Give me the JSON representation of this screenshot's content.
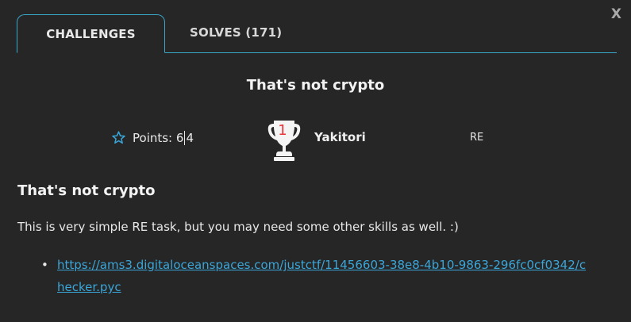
{
  "modal": {
    "close_label": "X"
  },
  "tabs": [
    {
      "label": "CHALLENGES",
      "active": true
    },
    {
      "label": "SOLVES (171)",
      "active": false
    }
  ],
  "challenge": {
    "name": "That's not crypto",
    "points_label": "Points: 6",
    "points_value": "4",
    "first_blood_rank": "1",
    "first_blood_team": "Yakitori",
    "category": "RE",
    "description_title": "That's not crypto",
    "description": "This is very simple RE task, but you may need some other skills as well. :)",
    "links": [
      "https://ams3.digitaloceanspaces.com/justctf/11456603-38e8-4b10-9863-296fc0cf0342/checker.pyc"
    ]
  },
  "icons": {
    "points": "star-outline-icon",
    "first_blood": "trophy-icon",
    "close": "close-icon"
  },
  "colors": {
    "background": "#262626",
    "accent": "#3aa6c9",
    "link": "#3aa6d9",
    "trophy_badge": "#e8343a"
  }
}
